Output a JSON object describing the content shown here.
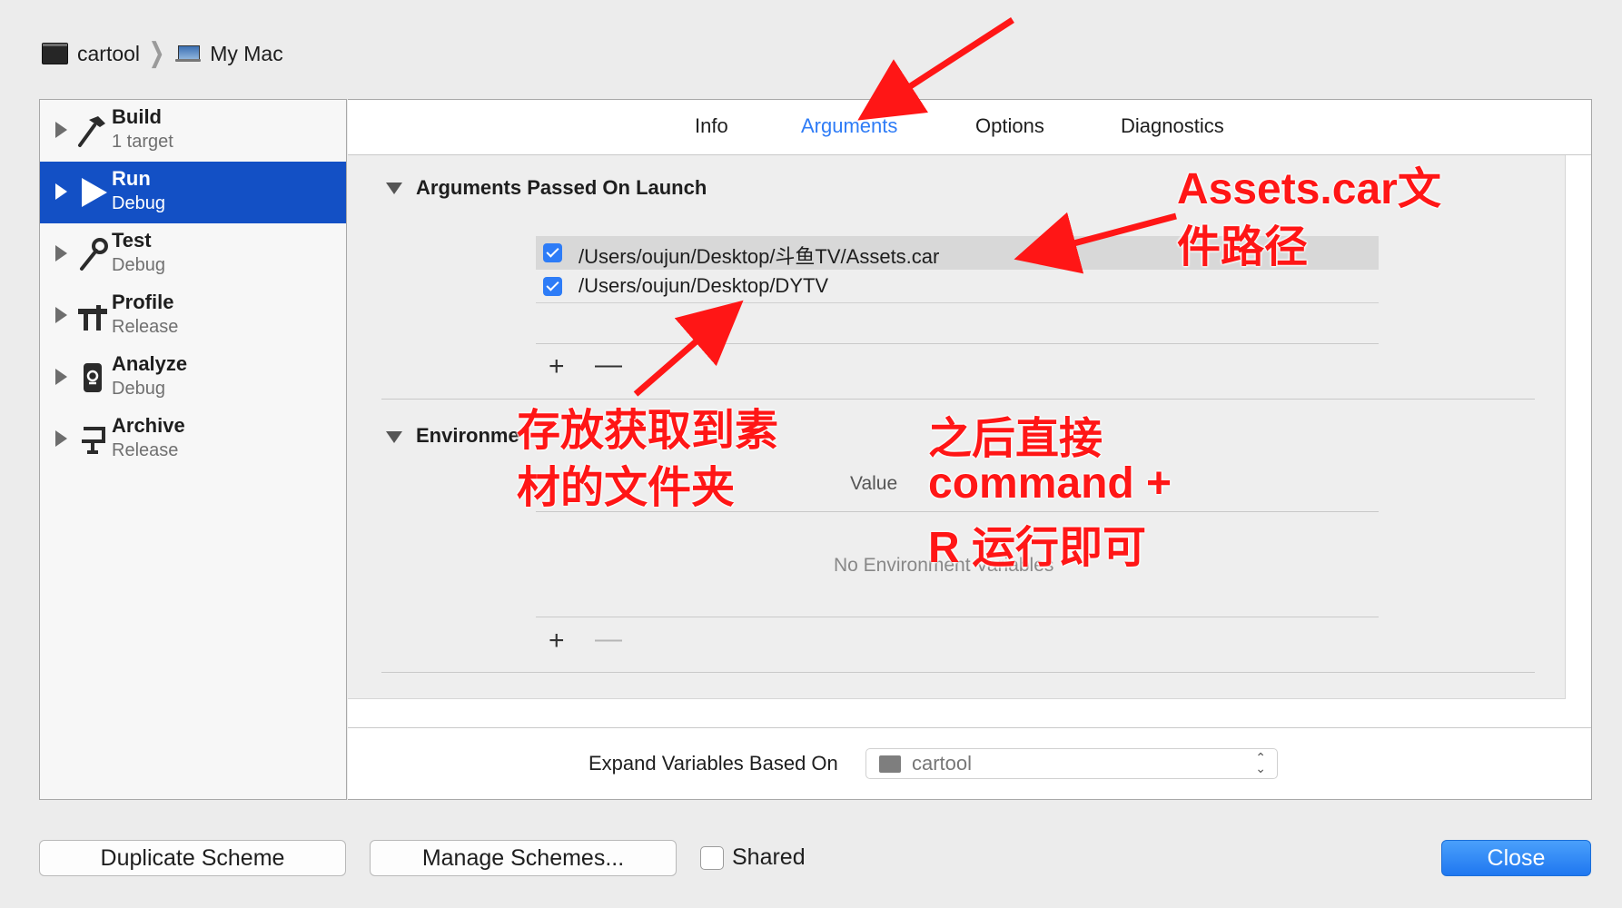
{
  "breadcrumb": {
    "scheme": "cartool",
    "destination": "My Mac"
  },
  "sidebar": {
    "items": [
      {
        "title": "Build",
        "subtitle": "1 target",
        "icon": "hammer-icon"
      },
      {
        "title": "Run",
        "subtitle": "Debug",
        "icon": "play-icon"
      },
      {
        "title": "Test",
        "subtitle": "Debug",
        "icon": "wrench-icon"
      },
      {
        "title": "Profile",
        "subtitle": "Release",
        "icon": "gauge-icon"
      },
      {
        "title": "Analyze",
        "subtitle": "Debug",
        "icon": "analyze-icon"
      },
      {
        "title": "Archive",
        "subtitle": "Release",
        "icon": "archive-icon"
      }
    ]
  },
  "tabs": {
    "info": "Info",
    "arguments": "Arguments",
    "options": "Options",
    "diagnostics": "Diagnostics"
  },
  "arguments": {
    "title": "Arguments Passed On Launch",
    "rows": [
      {
        "value": "/Users/oujun/Desktop/斗鱼TV/Assets.car",
        "checked": true
      },
      {
        "value": "/Users/oujun/Desktop/DYTV",
        "checked": true
      }
    ],
    "add": "+",
    "remove": "—"
  },
  "environment": {
    "title": "Environme",
    "value_header": "Value",
    "empty": "No Environment Variables",
    "add": "+",
    "remove": "—"
  },
  "expand": {
    "label": "Expand Variables Based On",
    "selected": "cartool"
  },
  "buttons": {
    "duplicate": "Duplicate Scheme",
    "manage": "Manage Schemes...",
    "shared": "Shared",
    "close": "Close"
  },
  "annotations": {
    "assets_line1": "Assets.car文",
    "assets_line2": "件路径",
    "folder_line1": "存放获取到素",
    "folder_line2": "材的文件夹",
    "run_line1": "之后直接",
    "run_line2": "command +",
    "run_line3": "R 运行即可"
  },
  "colors": {
    "accent": "#2f7cf6",
    "selection": "#1350c5",
    "annotation": "#ff1616"
  }
}
